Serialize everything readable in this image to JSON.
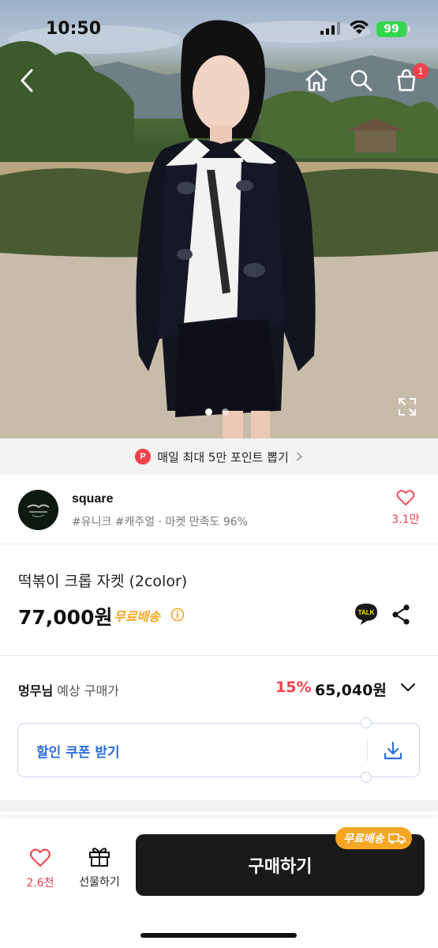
{
  "status_bar": {
    "time": "10:50",
    "battery": "99"
  },
  "nav": {
    "cart_count": "1"
  },
  "gallery": {
    "current_index": 1,
    "total": 2
  },
  "promo": {
    "badge": "P",
    "text": "매일 최대 5만 포인트 뽑기"
  },
  "seller": {
    "name": "square",
    "tags": "#유니크 #캐주얼 · 마켓 만족도 96%",
    "likes": "3.1만"
  },
  "product": {
    "title": "떡볶이 크롭 자켓 (2color)",
    "price": "77,000원",
    "shipping": "무료배송",
    "talk_label": "TALK"
  },
  "member_price": {
    "user": "멍무님",
    "label": "예상 구매가",
    "discount": "15%",
    "price": "65,040원"
  },
  "coupon": {
    "label": "할인 쿠폰 받기"
  },
  "bottom_bar": {
    "likes": "2.6천",
    "gift_label": "선물하기",
    "buy_label": "구매하기",
    "shipping_badge": "무료배송"
  },
  "colors": {
    "accent_red": "#f0424d",
    "shipping_orange": "#f5a623",
    "coupon_blue": "#2f6fdc",
    "buy_button": "#1a1a1a"
  }
}
